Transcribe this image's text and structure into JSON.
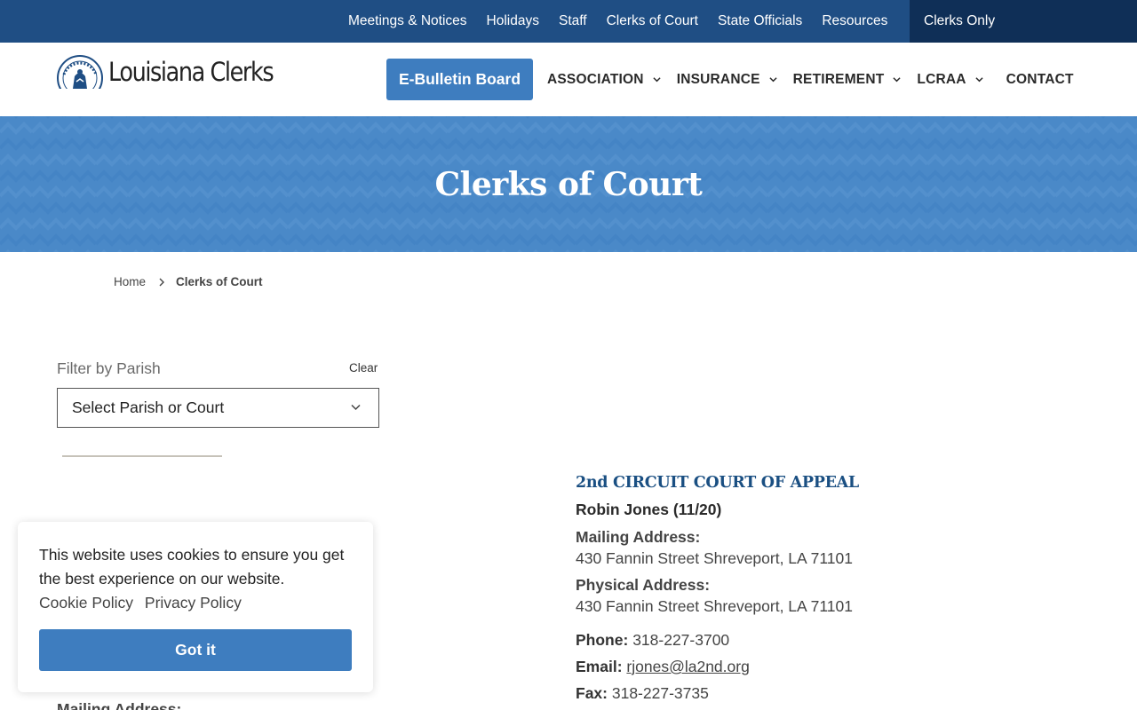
{
  "topbar": {
    "links": [
      "Meetings & Notices",
      "Holidays",
      "Staff",
      "Clerks of Court",
      "State Officials",
      "Resources"
    ],
    "clerks_only": "Clerks Only"
  },
  "header": {
    "logo_text": "Louisiana Clerks",
    "ebulletin_label": "E-Bulletin Board",
    "nav": {
      "association": "ASSOCIATION",
      "insurance": "INSURANCE",
      "retirement": "RETIREMENT",
      "lcraa": "LCRAA",
      "contact": "CONTACT"
    }
  },
  "banner": {
    "title": "Clerks of Court"
  },
  "breadcrumb": {
    "home": "Home",
    "current": "Clerks of Court"
  },
  "filter": {
    "label": "Filter by Parish",
    "clear": "Clear",
    "selected": "Select Parish or Court"
  },
  "entry": {
    "title": "2nd CIRCUIT COURT OF APPEAL",
    "name": "Robin Jones (11/20)",
    "mailing_label": "Mailing Address:",
    "mailing_value": "430 Fannin Street Shreveport, LA 71101",
    "physical_label": "Physical Address:",
    "physical_value": "430 Fannin Street Shreveport, LA 71101",
    "phone_label": "Phone:",
    "phone_value": "318-227-3700",
    "email_label": "Email:",
    "email_value": "rjones@la2nd.org",
    "fax_label": "Fax:",
    "fax_value": "318-227-3735"
  },
  "left_entry": {
    "mailing_label": "Mailing Address:"
  },
  "cookie": {
    "message": "This website uses cookies to ensure you get the best experience on our website.",
    "cookie_policy": "Cookie Policy",
    "privacy_policy": "Privacy Policy",
    "button": "Got it"
  },
  "colors": {
    "topbar": "#1f4e84",
    "clerks_only_bg": "#0f2f57",
    "primary_button": "#3e7dbf",
    "banner": "#4a89c8",
    "entry_title": "#1a4f82"
  }
}
